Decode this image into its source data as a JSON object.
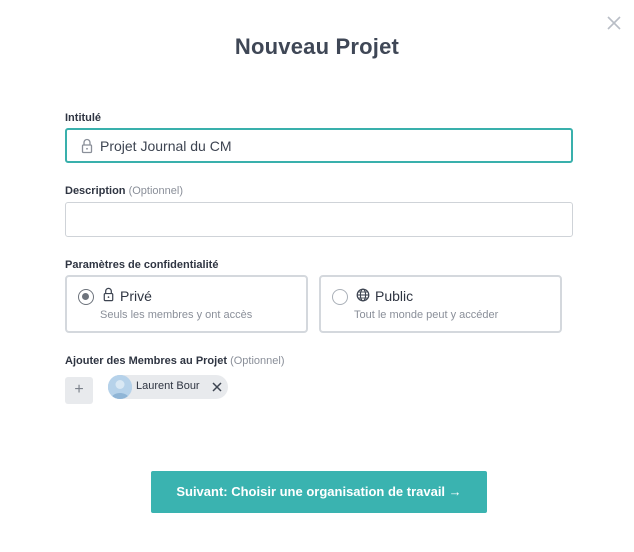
{
  "modal": {
    "title": "Nouveau Projet"
  },
  "icons": {
    "close": "close-icon",
    "lock": "lock-icon",
    "globe": "globe-icon",
    "plus": "plus-icon",
    "remove": "close-icon",
    "avatar": "user-avatar"
  },
  "name_field": {
    "label": "Intitulé",
    "value": "Projet Journal du CM"
  },
  "description_field": {
    "label": "Description",
    "optional": "(Optionnel)",
    "value": ""
  },
  "privacy": {
    "label": "Paramètres de confidentialité",
    "selected": "private",
    "options": [
      {
        "id": "private",
        "title": "Privé",
        "description": "Seuls les membres y ont accès"
      },
      {
        "id": "public",
        "title": "Public",
        "description": "Tout le monde peut y accéder"
      }
    ]
  },
  "members": {
    "label": "Ajouter des Membres au Projet",
    "optional": "(Optionnel)",
    "add_label": "+",
    "list": [
      {
        "name": "Laurent Bour"
      }
    ]
  },
  "footer": {
    "next_label": "Suivant: Choisir une organisation de travail →"
  },
  "colors": {
    "accent": "#3ab3b0",
    "focus_border": "#39b0ac",
    "title": "#3f4756",
    "muted": "#8a8f99"
  }
}
